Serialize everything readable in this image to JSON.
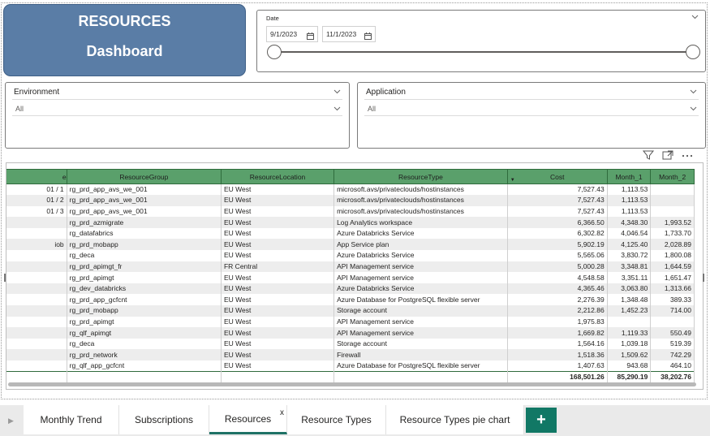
{
  "title": {
    "line1": "RESOURCES",
    "line2": "Dashboard"
  },
  "date_slicer": {
    "label": "Date",
    "start": "9/1/2023",
    "end": "11/1/2023"
  },
  "environment_slicer": {
    "label": "Environment",
    "value": "All"
  },
  "application_slicer": {
    "label": "Application",
    "value": "All"
  },
  "table": {
    "columns": [
      "e",
      "ResourceGroup",
      "ResourceLocation",
      "ResourceType",
      "Cost",
      "Month_1",
      "Month_2"
    ],
    "rows": [
      [
        "01 / 1",
        "rg_prd_app_avs_we_001",
        "EU West",
        "microsoft.avs/privateclouds/hostinstances",
        "7,527.43",
        "1,113.53",
        ""
      ],
      [
        "01 / 2",
        "rg_prd_app_avs_we_001",
        "EU West",
        "microsoft.avs/privateclouds/hostinstances",
        "7,527.43",
        "1,113.53",
        ""
      ],
      [
        "01 / 3",
        "rg_prd_app_avs_we_001",
        "EU West",
        "microsoft.avs/privateclouds/hostinstances",
        "7,527.43",
        "1,113.53",
        ""
      ],
      [
        "",
        "rg_prd_azmigrate",
        "EU West",
        "Log Analytics workspace",
        "6,366.50",
        "4,348.30",
        "1,993.52"
      ],
      [
        "",
        "rg_datafabrics",
        "EU West",
        "Azure Databricks Service",
        "6,302.82",
        "4,046.54",
        "1,733.70"
      ],
      [
        "iob",
        "rg_prd_mobapp",
        "EU West",
        "App Service plan",
        "5,902.19",
        "4,125.40",
        "2,028.89"
      ],
      [
        "",
        "rg_deca",
        "EU West",
        "Azure Databricks Service",
        "5,565.06",
        "3,830.72",
        "1,800.08"
      ],
      [
        "",
        "rg_prd_apimgt_fr",
        "FR Central",
        "API Management service",
        "5,000.28",
        "3,348.81",
        "1,644.59"
      ],
      [
        "",
        "rg_prd_apimgt",
        "EU West",
        "API Management service",
        "4,548.58",
        "3,351.11",
        "1,651.47"
      ],
      [
        "",
        "rg_dev_databricks",
        "EU West",
        "Azure Databricks Service",
        "4,365.46",
        "3,063.80",
        "1,313.66"
      ],
      [
        "",
        "rg_prd_app_gcfcnt",
        "EU West",
        "Azure Database for PostgreSQL flexible server",
        "2,276.39",
        "1,348.48",
        "389.33"
      ],
      [
        "",
        "rg_prd_mobapp",
        "EU West",
        "Storage account",
        "2,212.86",
        "1,452.23",
        "714.00"
      ],
      [
        "",
        "rg_prd_apimgt",
        "EU West",
        "API Management service",
        "1,975.83",
        "",
        ""
      ],
      [
        "",
        "rg_qlf_apimgt",
        "EU West",
        "API Management service",
        "1,669.82",
        "1,119.33",
        "550.49"
      ],
      [
        "",
        "rg_deca",
        "EU West",
        "Storage account",
        "1,564.16",
        "1,039.18",
        "519.39"
      ],
      [
        "",
        "rg_prd_network",
        "EU West",
        "Firewall",
        "1,518.36",
        "1,509.62",
        "742.29"
      ],
      [
        "",
        "rg_qlf_app_gcfcnt",
        "EU West",
        "Azure Database for PostgreSQL flexible server",
        "1,407.63",
        "943.68",
        "464.10"
      ]
    ],
    "totals": [
      "",
      "",
      "",
      "",
      "168,501.26",
      "85,290.19",
      "38,202.76"
    ]
  },
  "tabs": [
    {
      "label": "Monthly Trend"
    },
    {
      "label": "Subscriptions"
    },
    {
      "label": "Resources",
      "close": "x"
    },
    {
      "label": "Resource Types"
    },
    {
      "label": "Resource Types pie chart"
    }
  ],
  "add_tab_label": "+"
}
